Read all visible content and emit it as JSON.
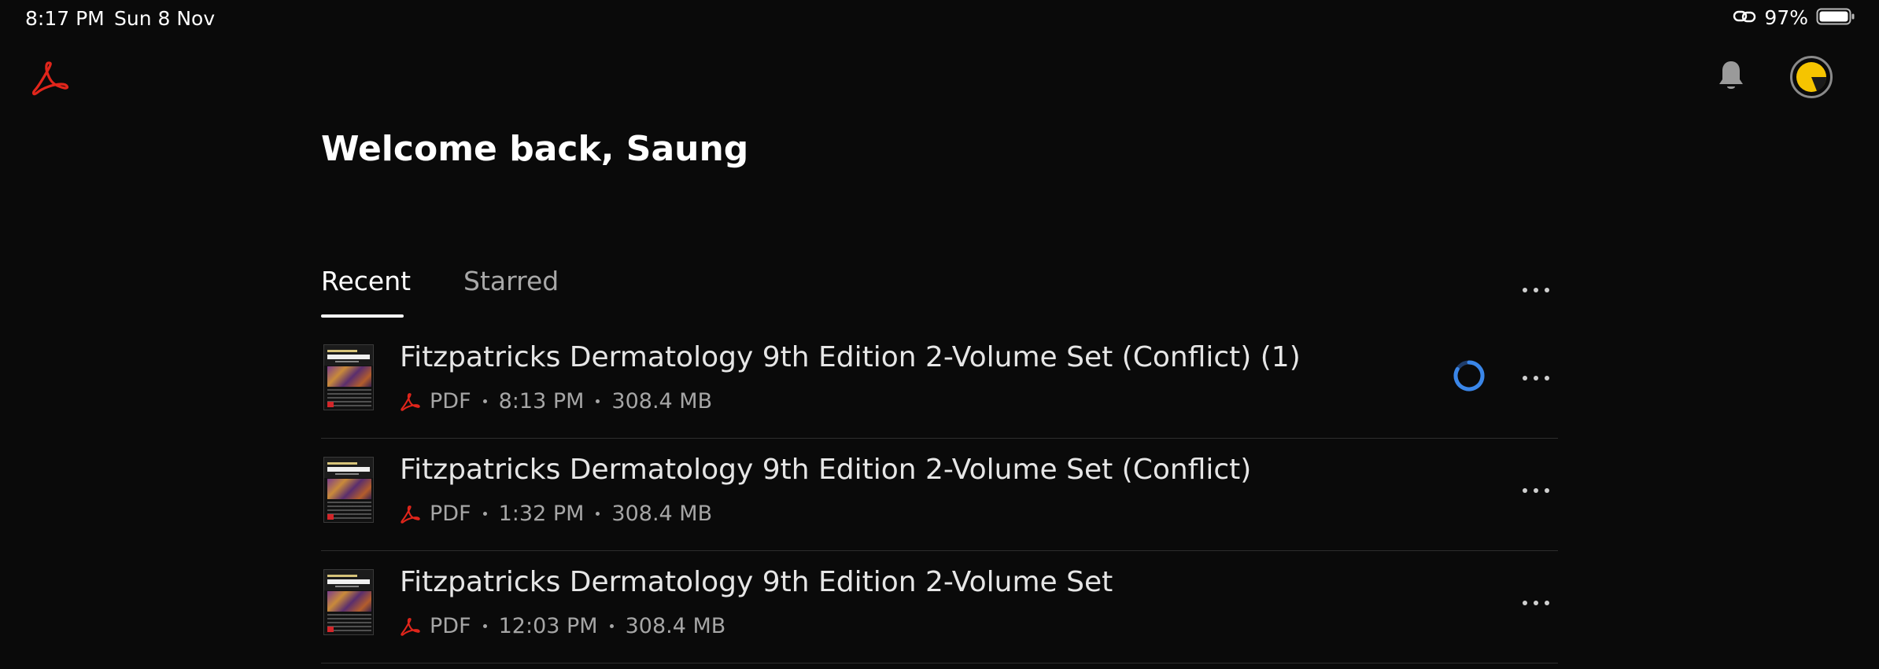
{
  "status_bar": {
    "time": "8:17 PM",
    "date": "Sun 8 Nov",
    "battery": "97%",
    "link_icon": "link-icon",
    "battery_icon": "battery-icon"
  },
  "header": {
    "logo_icon": "acrobat-logo-icon",
    "bell_icon": "bell-icon",
    "avatar_icon": "avatar-icon"
  },
  "welcome": "Welcome back, Saung",
  "tabs": [
    {
      "label": "Recent",
      "active": true
    },
    {
      "label": "Starred",
      "active": false
    }
  ],
  "colors": {
    "background": "#0a0a0a",
    "accent_red": "#e1251b",
    "spinner_blue": "#3a86e8",
    "avatar_yellow": "#f5c400",
    "divider": "#2e2e2e"
  },
  "files": [
    {
      "title": "Fitzpatricks Dermatology 9th Edition 2-Volume Set (Conflict) (1)",
      "type": "PDF",
      "time": "8:13 PM",
      "size": "308.4 MB",
      "syncing": true
    },
    {
      "title": "Fitzpatricks Dermatology 9th Edition 2-Volume Set (Conflict)",
      "type": "PDF",
      "time": "1:32 PM",
      "size": "308.4 MB",
      "syncing": false
    },
    {
      "title": "Fitzpatricks Dermatology 9th Edition 2-Volume Set",
      "type": "PDF",
      "time": "12:03 PM",
      "size": "308.4 MB",
      "syncing": false
    }
  ]
}
